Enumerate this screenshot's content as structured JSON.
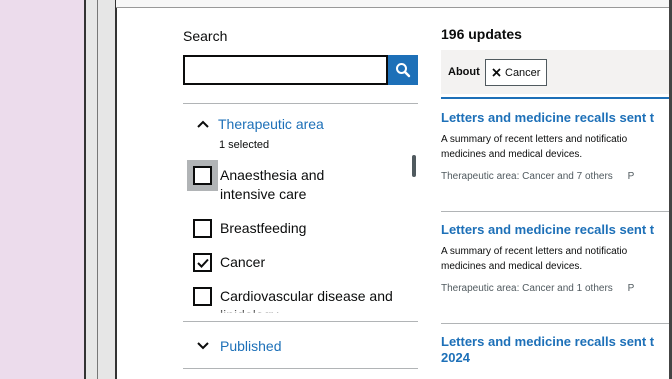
{
  "search": {
    "label": "Search",
    "value": "",
    "placeholder": ""
  },
  "filters": {
    "therapeutic_area": {
      "title": "Therapeutic area",
      "selected_count": "1 selected",
      "options": [
        {
          "label": "Anaesthesia and intensive care",
          "checked": false
        },
        {
          "label": "Breastfeeding",
          "checked": false
        },
        {
          "label": "Cancer",
          "checked": true
        },
        {
          "label": "Cardiovascular disease and lipidology",
          "checked": false
        }
      ]
    },
    "published": {
      "title": "Published"
    }
  },
  "results": {
    "count": "196 updates",
    "about_label": "About",
    "chip_label": "Cancer",
    "items": [
      {
        "title": "Letters and medicine recalls sent t",
        "desc_line1": "A summary of recent letters and notificatio",
        "desc_line2": "medicines and medical devices.",
        "meta": "Therapeutic area: Cancer and 7 others",
        "meta_extra": "P"
      },
      {
        "title": "Letters and medicine recalls sent t",
        "desc_line1": "A summary of recent letters and notificatio",
        "desc_line2": "medicines and medical devices.",
        "meta": "Therapeutic area: Cancer and 1 others",
        "meta_extra": "P"
      },
      {
        "title": "Letters and medicine recalls sent t",
        "title_line2": "2024"
      }
    ]
  },
  "colors": {
    "link": "#1d70b8",
    "text": "#0b0c0c",
    "focus": "#b1b4b6"
  }
}
